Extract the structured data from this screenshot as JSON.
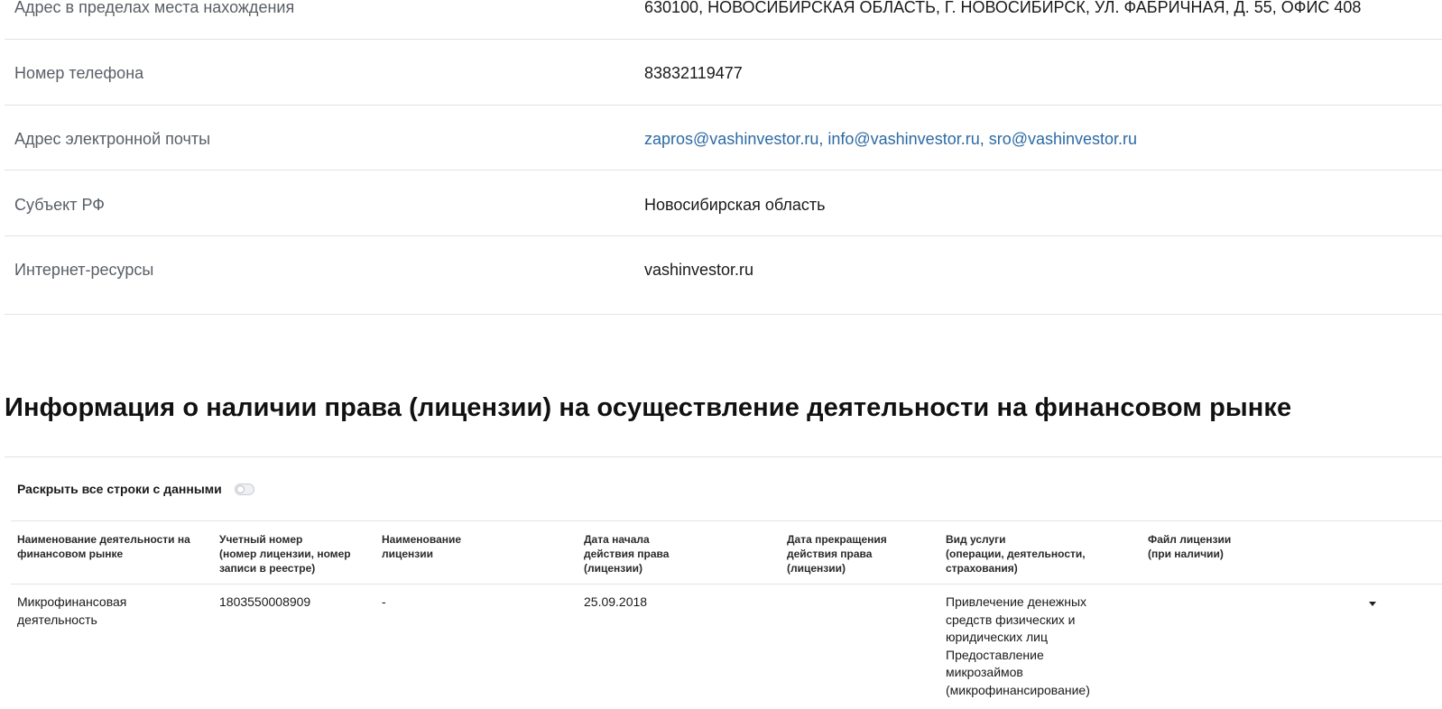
{
  "info_rows": [
    {
      "label": "Адрес в пределах места нахождения",
      "value": "630100, НОВОСИБИРСКАЯ ОБЛАСТЬ, Г. НОВОСИБИРСК, УЛ. ФАБРИЧНАЯ, Д. 55, ОФИС 408"
    },
    {
      "label": "Номер телефона",
      "value": "83832119477"
    },
    {
      "label": "Адрес электронной почты",
      "value": "zapros@vashinvestor.ru, info@vashinvestor.ru, sro@vashinvestor.ru"
    },
    {
      "label": "Субъект РФ",
      "value": "Новосибирская область"
    },
    {
      "label": "Интернет-ресурсы",
      "value": "vashinvestor.ru"
    }
  ],
  "license_section": {
    "title": "Информация о наличии права (лицензии) на осуществление деятельности на финансовом рынке",
    "expand_all_label": "Раскрыть все строки с данными",
    "expand_all_on": false,
    "columns": [
      [
        "Наименование деятельности на",
        "финансовом рынке"
      ],
      [
        "Учетный номер",
        "(номер лицензии, номер",
        "записи в реестре)"
      ],
      [
        "Наименование",
        "лицензии"
      ],
      [
        "Дата начала",
        "действия права",
        "(лицензии)"
      ],
      [
        "Дата прекращения",
        "действия права",
        "(лицензии)"
      ],
      [
        "Вид услуги",
        "(операции, деятельности,",
        "страхования)"
      ],
      [
        "Файл лицензии",
        "(при наличии)"
      ]
    ],
    "rows": [
      {
        "activity": [
          "Микрофинансовая",
          "деятельность"
        ],
        "reg_number": "1803550008909",
        "license_name": "-",
        "start_date": "25.09.2018",
        "end_date": "",
        "service_type": [
          "Привлечение денежных",
          "средств физических и",
          "юридических лиц",
          "Предоставление",
          "микрозаймов",
          "(микрофинансирование)"
        ],
        "license_file": ""
      }
    ]
  }
}
